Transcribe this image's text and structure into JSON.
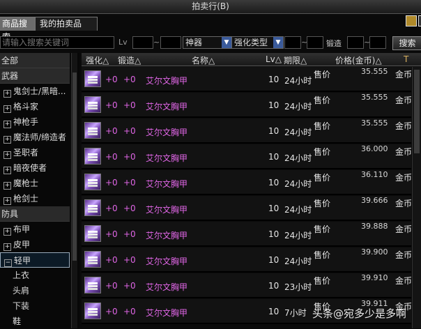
{
  "window": {
    "title": "拍卖行(B)"
  },
  "tabs": [
    {
      "label": "商品搜索",
      "active": true
    },
    {
      "label": "我的拍卖品",
      "active": false
    }
  ],
  "toolbar": {
    "search_placeholder": "请输入搜索关键词",
    "lv_label": "Lv",
    "tilde1": "~",
    "rarity_select": "神器",
    "enhance_select": "强化类型",
    "tilde2": "~",
    "forge_label": "锻造",
    "tilde3": "~",
    "search_button": "搜索"
  },
  "tree": {
    "items": [
      {
        "label": "全部",
        "type": "header"
      },
      {
        "label": "武器",
        "type": "header"
      },
      {
        "label": "鬼剑士/黑暗...",
        "type": "expand"
      },
      {
        "label": "格斗家",
        "type": "expand"
      },
      {
        "label": "神枪手",
        "type": "expand"
      },
      {
        "label": "魔法师/缔造者",
        "type": "expand"
      },
      {
        "label": "圣职者",
        "type": "expand"
      },
      {
        "label": "暗夜使者",
        "type": "expand"
      },
      {
        "label": "魔枪士",
        "type": "expand"
      },
      {
        "label": "枪剑士",
        "type": "expand"
      },
      {
        "label": "防具",
        "type": "header"
      },
      {
        "label": "布甲",
        "type": "expand"
      },
      {
        "label": "皮甲",
        "type": "expand"
      },
      {
        "label": "轻甲",
        "type": "collapse",
        "selected": true
      },
      {
        "label": "上衣",
        "type": "child"
      },
      {
        "label": "头肩",
        "type": "child"
      },
      {
        "label": "下装",
        "type": "child"
      },
      {
        "label": "鞋",
        "type": "child"
      }
    ]
  },
  "list": {
    "columns": {
      "enhance": "强化△",
      "forge": "锻造△",
      "name": "名称△",
      "lv": "Lv△",
      "time": "期限△",
      "price": "价格(金币)△",
      "extra": "T"
    },
    "rows": [
      {
        "enhance": "+0",
        "forge": "+0",
        "name": "艾尔文胸甲",
        "lv": "10",
        "time": "24小时",
        "type": "售价",
        "price": "35.555",
        "currency": "金币"
      },
      {
        "enhance": "+0",
        "forge": "+0",
        "name": "艾尔文胸甲",
        "lv": "10",
        "time": "24小时",
        "type": "售价",
        "price": "35.555",
        "currency": "金币"
      },
      {
        "enhance": "+0",
        "forge": "+0",
        "name": "艾尔文胸甲",
        "lv": "10",
        "time": "24小时",
        "type": "售价",
        "price": "35.555",
        "currency": "金币"
      },
      {
        "enhance": "+0",
        "forge": "+0",
        "name": "艾尔文胸甲",
        "lv": "10",
        "time": "24小时",
        "type": "售价",
        "price": "36.000",
        "currency": "金币"
      },
      {
        "enhance": "+0",
        "forge": "+0",
        "name": "艾尔文胸甲",
        "lv": "10",
        "time": "24小时",
        "type": "售价",
        "price": "36.110",
        "currency": "金币"
      },
      {
        "enhance": "+0",
        "forge": "+0",
        "name": "艾尔文胸甲",
        "lv": "10",
        "time": "24小时",
        "type": "售价",
        "price": "39.666",
        "currency": "金币"
      },
      {
        "enhance": "+0",
        "forge": "+0",
        "name": "艾尔文胸甲",
        "lv": "10",
        "time": "24小时",
        "type": "售价",
        "price": "39.888",
        "currency": "金币"
      },
      {
        "enhance": "+0",
        "forge": "+0",
        "name": "艾尔文胸甲",
        "lv": "10",
        "time": "24小时",
        "type": "售价",
        "price": "39.900",
        "currency": "金币"
      },
      {
        "enhance": "+0",
        "forge": "+0",
        "name": "艾尔文胸甲",
        "lv": "10",
        "time": "23小时",
        "type": "售价",
        "price": "39.910",
        "currency": "金币"
      },
      {
        "enhance": "+0",
        "forge": "+0",
        "name": "艾尔文胸甲",
        "lv": "10",
        "time": "7小时",
        "type": "售价",
        "price": "39.911",
        "currency": "金币"
      }
    ]
  },
  "watermark": "头条@宛多少是多啊"
}
